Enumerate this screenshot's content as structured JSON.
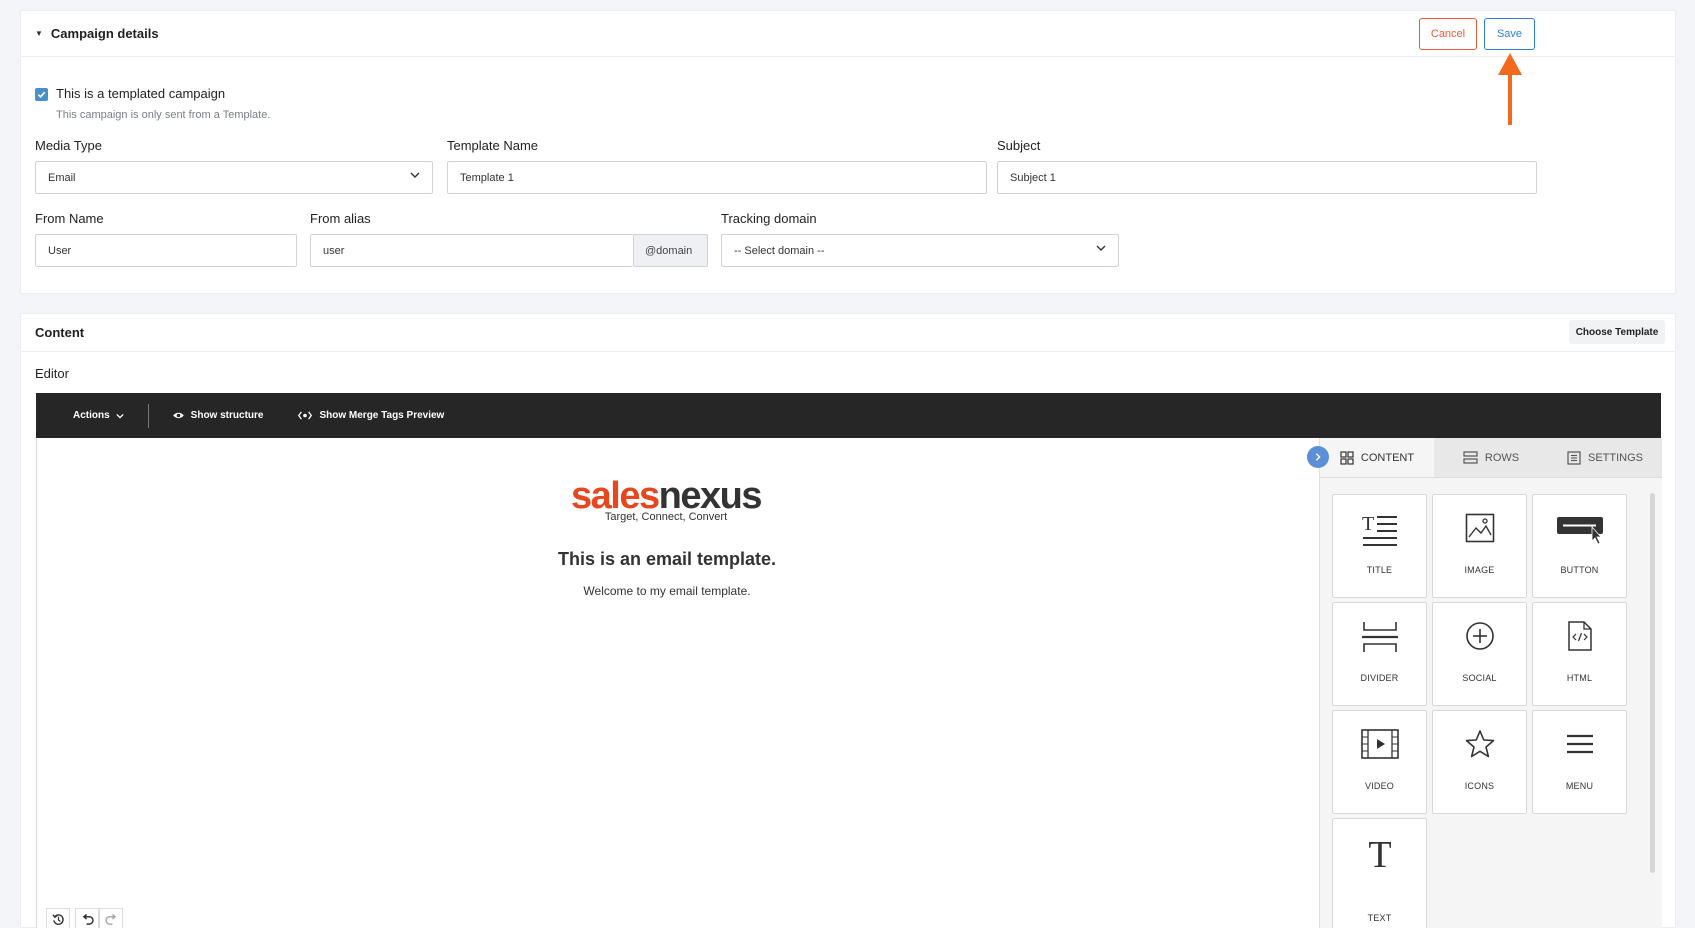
{
  "campaign": {
    "title": "Campaign details",
    "cancel_label": "Cancel",
    "save_label": "Save",
    "templated_checkbox_label": "This is a templated campaign",
    "templated_checkbox_checked": true,
    "templated_help": "This campaign is only sent from a Template.",
    "media_type_label": "Media Type",
    "media_type_value": "Email",
    "template_name_label": "Template Name",
    "template_name_value": "Template 1",
    "subject_label": "Subject",
    "subject_value": "Subject 1",
    "from_name_label": "From Name",
    "from_name_value": "User",
    "from_alias_label": "From alias",
    "from_alias_value": "user",
    "from_alias_suffix": "@domain",
    "tracking_domain_label": "Tracking domain",
    "tracking_domain_value": "-- Select domain --"
  },
  "content": {
    "title": "Content",
    "choose_template_label": "Choose Template",
    "editor_label": "Editor"
  },
  "editor": {
    "toolbar": {
      "actions_label": "Actions",
      "show_structure_label": "Show structure",
      "merge_tags_label": "Show Merge Tags Preview"
    },
    "email": {
      "logo_text_a": "sales",
      "logo_text_b": "nexus",
      "logo_tagline": "Target, Connect, Convert",
      "heading": "This is an email template.",
      "body": "Welcome to my email template."
    },
    "panel": {
      "tabs": [
        {
          "label": "CONTENT",
          "icon": "grid-icon",
          "active": true
        },
        {
          "label": "ROWS",
          "icon": "rows-icon",
          "active": false
        },
        {
          "label": "SETTINGS",
          "icon": "settings-list-icon",
          "active": false
        }
      ],
      "blocks": [
        {
          "label": "TITLE",
          "icon": "title-icon"
        },
        {
          "label": "IMAGE",
          "icon": "image-icon"
        },
        {
          "label": "BUTTON",
          "icon": "button-icon"
        },
        {
          "label": "DIVIDER",
          "icon": "divider-icon"
        },
        {
          "label": "SOCIAL",
          "icon": "social-icon"
        },
        {
          "label": "HTML",
          "icon": "html-icon"
        },
        {
          "label": "VIDEO",
          "icon": "video-icon"
        },
        {
          "label": "ICONS",
          "icon": "star-icon"
        },
        {
          "label": "MENU",
          "icon": "menu-icon"
        },
        {
          "label": "TEXT",
          "icon": "text-icon"
        }
      ]
    }
  },
  "colors": {
    "accent_blue": "#2f80d1",
    "cancel_orange": "#e8593a",
    "arrow_orange": "#f26b1d",
    "checkbox_blue": "#4a90c8",
    "logo_orange": "#e5481f",
    "logo_dark": "#333333"
  }
}
